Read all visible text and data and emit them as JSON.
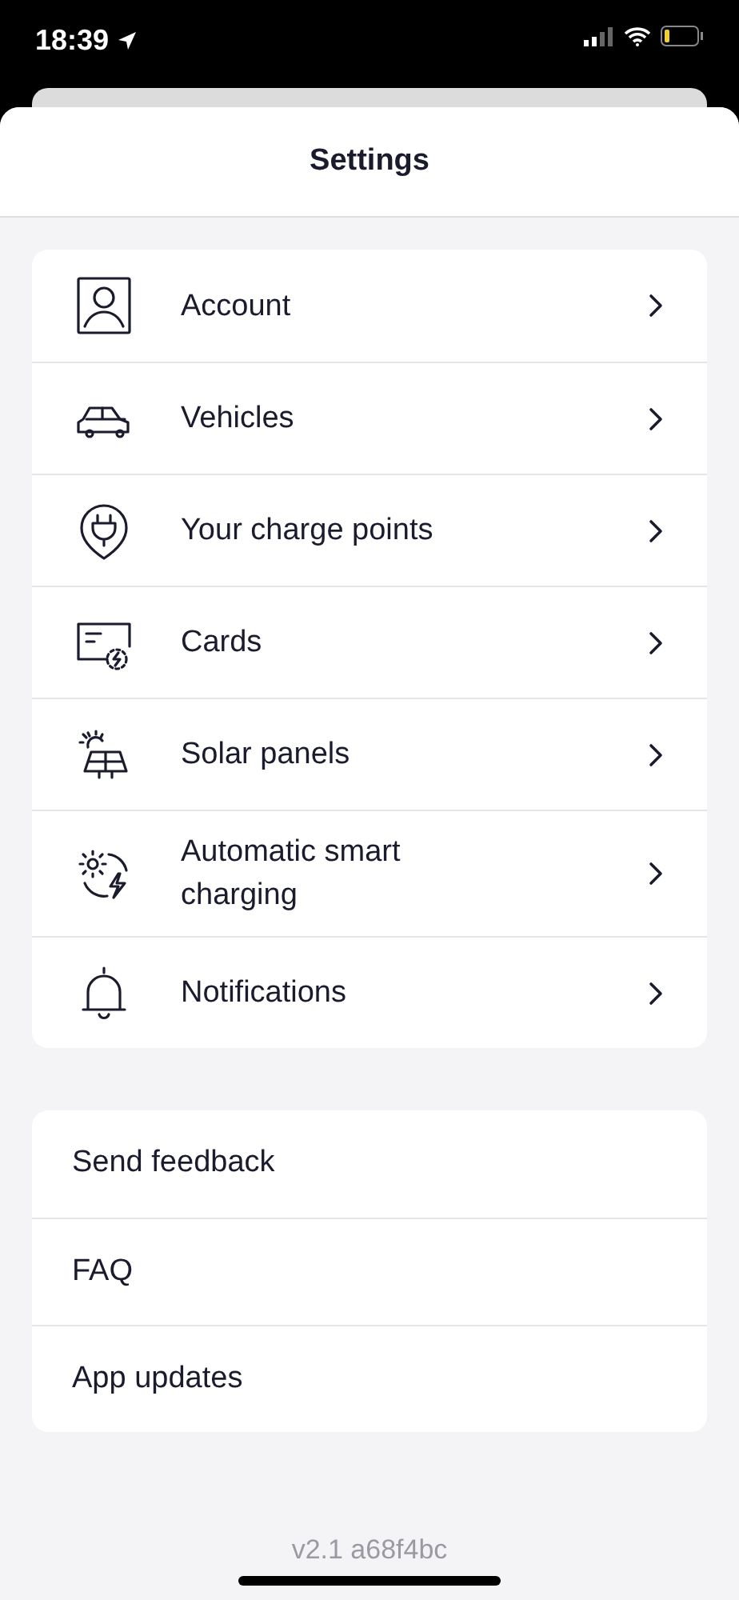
{
  "status_bar": {
    "time": "18:39"
  },
  "header": {
    "title": "Settings"
  },
  "menu": [
    {
      "label": "Account",
      "kind": "person"
    },
    {
      "label": "Vehicles",
      "kind": "car"
    },
    {
      "label": "Your charge points",
      "kind": "plug"
    },
    {
      "label": "Cards",
      "kind": "card"
    },
    {
      "label": "Solar panels",
      "kind": "solar"
    },
    {
      "label": "Automatic smart charging",
      "kind": "smart"
    },
    {
      "label": "Notifications",
      "kind": "bell"
    }
  ],
  "links": [
    {
      "label": "Send feedback"
    },
    {
      "label": "FAQ"
    },
    {
      "label": "App updates"
    }
  ],
  "version": "v2.1 a68f4bc"
}
